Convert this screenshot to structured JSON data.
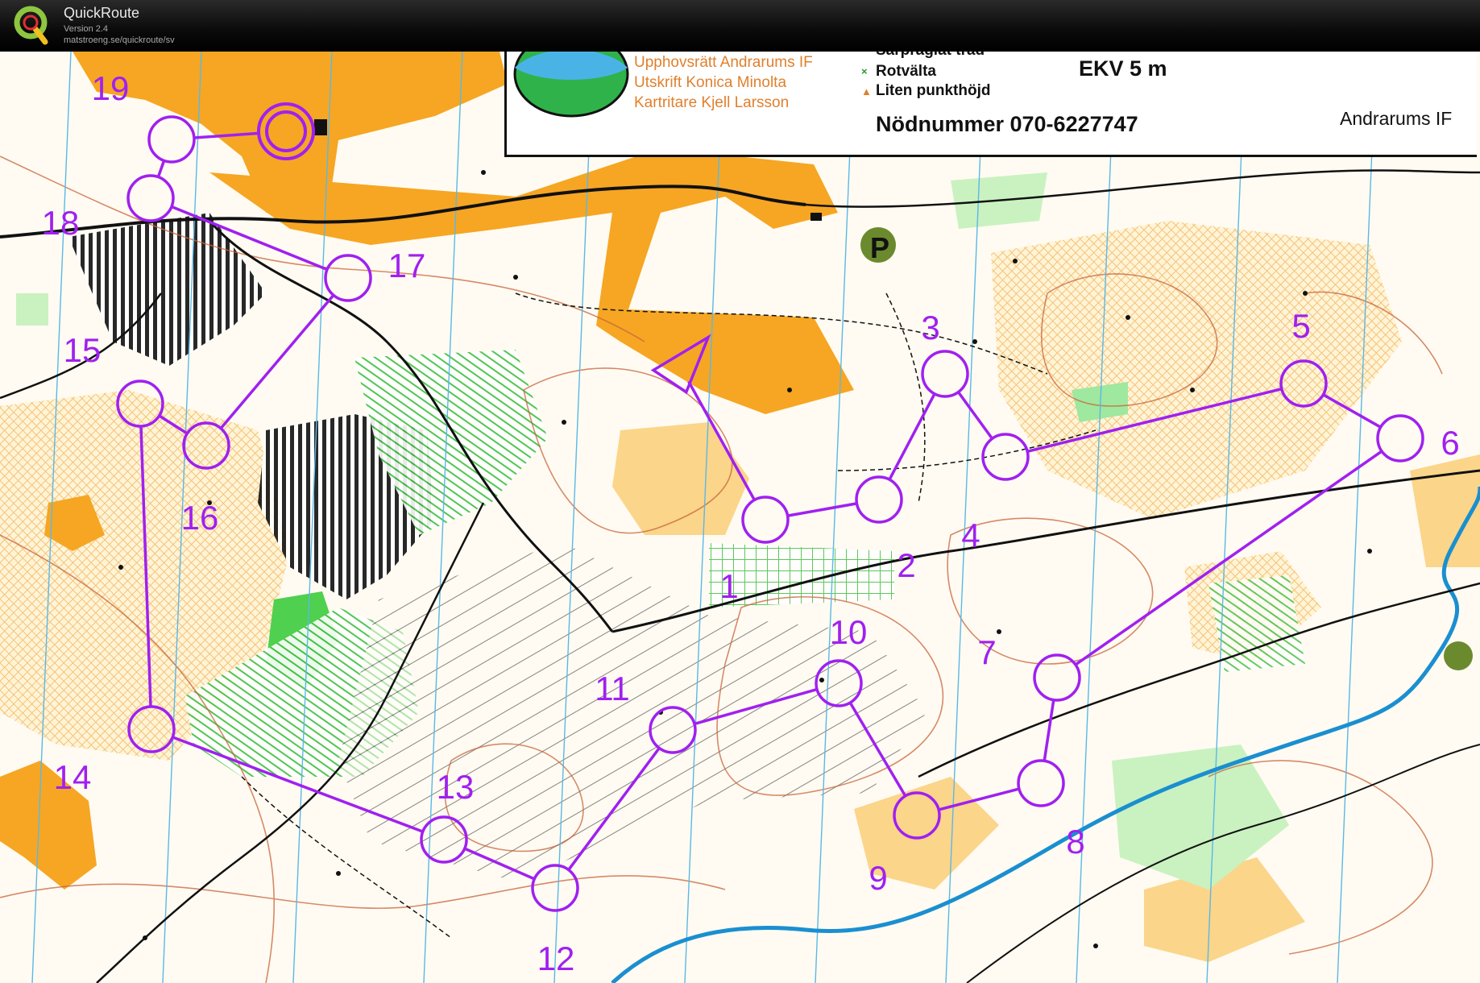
{
  "app": {
    "title": "QuickRoute",
    "version": "Version 2.4",
    "url": "matstroeng.se/quickroute/sv"
  },
  "map": {
    "credits": [
      "Upphovsrätt Andrarums IF",
      "Utskrift Konica Minolta",
      "Kartritare Kjell Larsson"
    ],
    "legend_items": [
      {
        "symbol": "○",
        "label": "Särpräglat träd"
      },
      {
        "symbol": "×",
        "label": "Rotvälta"
      },
      {
        "symbol": "▲",
        "label": "Liten punkthöjd"
      }
    ],
    "equidistance": "EKV 5 m",
    "emergency_number": "Nödnummer 070-6227747",
    "club_name": "Andrarums IF",
    "course_color": "#a020f0",
    "controls": [
      {
        "id": "start",
        "label": ""
      },
      {
        "id": "1",
        "label": "1"
      },
      {
        "id": "2",
        "label": "2"
      },
      {
        "id": "3",
        "label": "3"
      },
      {
        "id": "4",
        "label": "4"
      },
      {
        "id": "5",
        "label": "5"
      },
      {
        "id": "6",
        "label": "6"
      },
      {
        "id": "7",
        "label": "7"
      },
      {
        "id": "8",
        "label": "8"
      },
      {
        "id": "9",
        "label": "9"
      },
      {
        "id": "10",
        "label": "10"
      },
      {
        "id": "11",
        "label": "11"
      },
      {
        "id": "12",
        "label": "12"
      },
      {
        "id": "13",
        "label": "13"
      },
      {
        "id": "14",
        "label": "14"
      },
      {
        "id": "15",
        "label": "15"
      },
      {
        "id": "16",
        "label": "16"
      },
      {
        "id": "17",
        "label": "17"
      },
      {
        "id": "18",
        "label": "18"
      },
      {
        "id": "19",
        "label": "19"
      },
      {
        "id": "finish",
        "label": ""
      }
    ]
  }
}
